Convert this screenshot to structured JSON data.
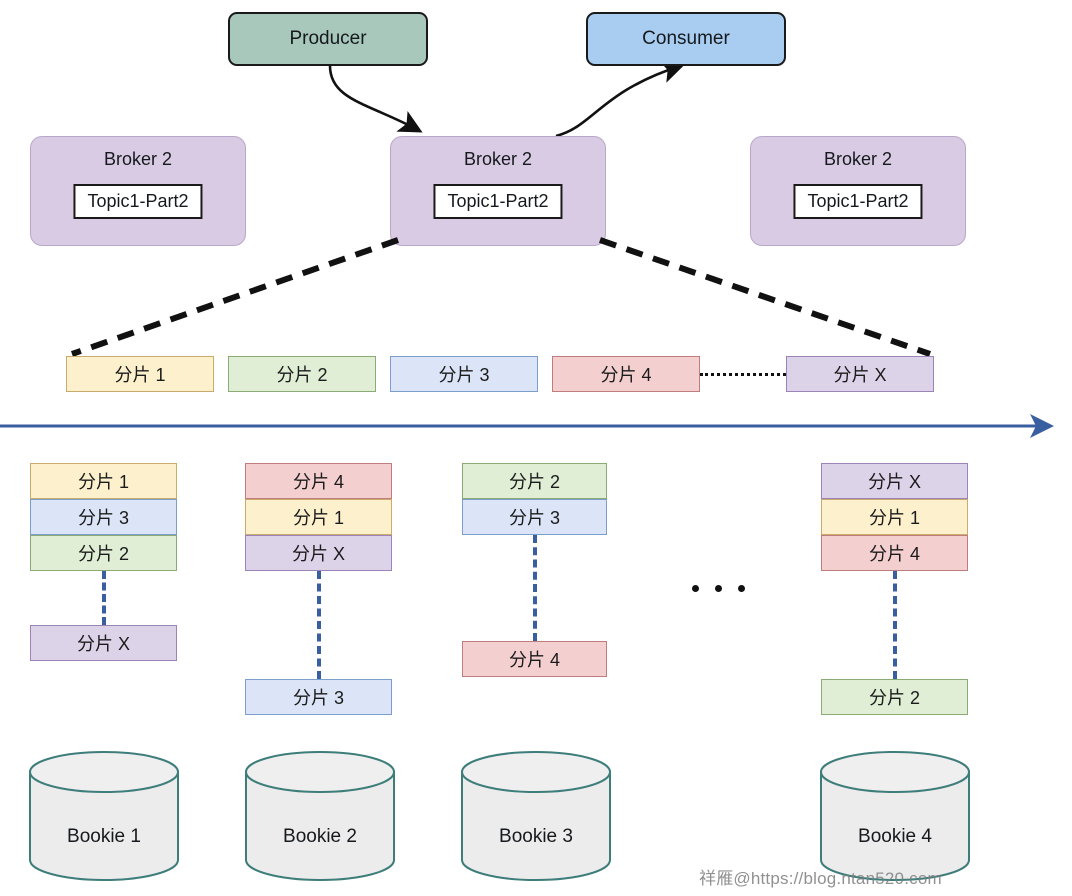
{
  "title": "Pulsar topic partition sharding across bookies",
  "colors": {
    "producer_fill": "#a8c8bb",
    "consumer_fill": "#a8cdf0",
    "broker_fill": "#d8cbe3",
    "shard_yellow": "#fdf0cd",
    "shard_green": "#dfeed4",
    "shard_blue": "#dbe5f7",
    "shard_red": "#f3cfcf",
    "shard_purple": "#ddd3e9",
    "timeline_arrow": "#3a5fa0",
    "cylinder_stroke": "#3d7d7a",
    "cylinder_fill": "#ececec",
    "dashed_black": "#111111"
  },
  "actors": {
    "producer": "Producer",
    "consumer": "Consumer"
  },
  "brokers": [
    {
      "title": "Broker 2",
      "topic": "Topic1-Part2"
    },
    {
      "title": "Broker 2",
      "topic": "Topic1-Part2"
    },
    {
      "title": "Broker 2",
      "topic": "Topic1-Part2"
    }
  ],
  "shard_row": [
    {
      "label": "分片 1",
      "color": "yellow"
    },
    {
      "label": "分片 2",
      "color": "green"
    },
    {
      "label": "分片 3",
      "color": "blue"
    },
    {
      "label": "分片 4",
      "color": "red"
    },
    {
      "label": "分片 X",
      "color": "purple"
    }
  ],
  "bookie_columns": [
    {
      "bookie": "Bookie 1",
      "top_stack": [
        {
          "label": "分片 1",
          "color": "yellow"
        },
        {
          "label": "分片 3",
          "color": "blue"
        },
        {
          "label": "分片 2",
          "color": "green"
        }
      ],
      "tail": {
        "label": "分片 X",
        "color": "purple"
      }
    },
    {
      "bookie": "Bookie 2",
      "top_stack": [
        {
          "label": "分片 4",
          "color": "red"
        },
        {
          "label": "分片 1",
          "color": "yellow"
        },
        {
          "label": "分片 X",
          "color": "purple"
        }
      ],
      "tail": {
        "label": "分片 3",
        "color": "blue"
      }
    },
    {
      "bookie": "Bookie 3",
      "top_stack": [
        {
          "label": "分片 2",
          "color": "green"
        },
        {
          "label": "分片 3",
          "color": "blue"
        }
      ],
      "tail": {
        "label": "分片 4",
        "color": "red"
      }
    },
    {
      "bookie": "Bookie 4",
      "top_stack": [
        {
          "label": "分片 X",
          "color": "purple"
        },
        {
          "label": "分片 1",
          "color": "yellow"
        },
        {
          "label": "分片 4",
          "color": "red"
        }
      ],
      "tail": {
        "label": "分片 2",
        "color": "green"
      }
    }
  ],
  "ellipsis": "• • •",
  "watermark": "祥雁@https://blog.ntan520.com"
}
